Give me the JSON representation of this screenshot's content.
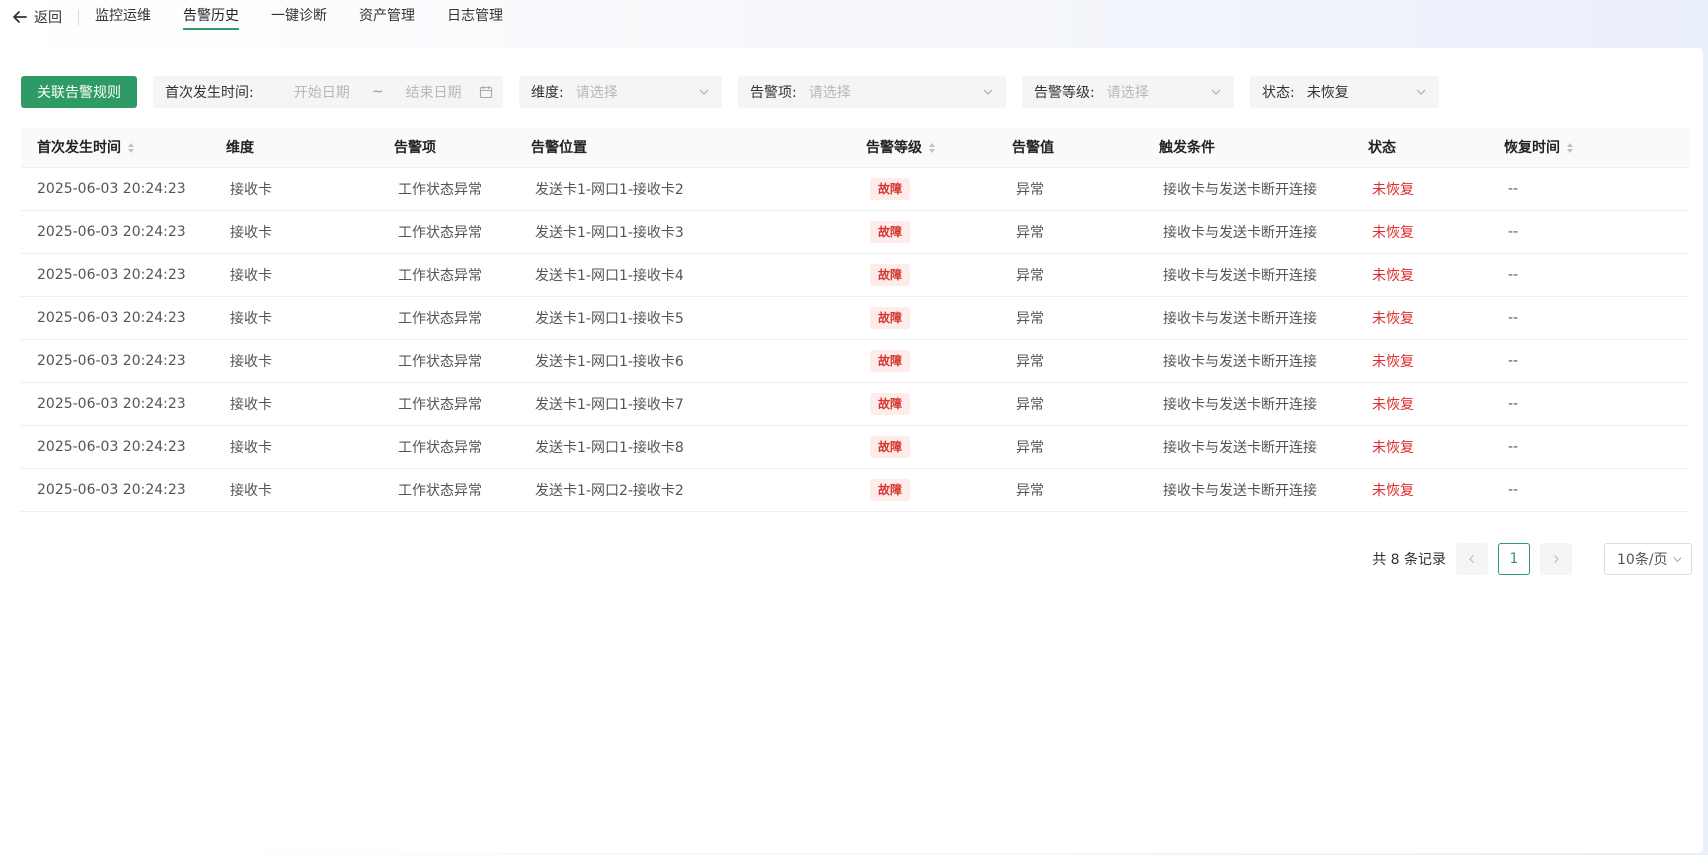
{
  "nav": {
    "back_label": "返回",
    "tabs": [
      {
        "label": "监控运维"
      },
      {
        "label": "告警历史"
      },
      {
        "label": "一键诊断"
      },
      {
        "label": "资产管理"
      },
      {
        "label": "日志管理"
      }
    ],
    "active_tab": 1
  },
  "filters": {
    "rule_button": "关联告警规则",
    "time_label": "首次发生时间:",
    "start_placeholder": "开始日期",
    "range_sep": "~",
    "end_placeholder": "结束日期",
    "dimension_label": "维度:",
    "dimension_placeholder": "请选择",
    "item_label": "告警项:",
    "item_placeholder": "请选择",
    "level_label": "告警等级:",
    "level_placeholder": "请选择",
    "status_label": "状态:",
    "status_value": "未恢复"
  },
  "table": {
    "headers": {
      "time": "首次发生时间",
      "dimension": "维度",
      "item": "告警项",
      "location": "告警位置",
      "level": "告警等级",
      "value": "告警值",
      "condition": "触发条件",
      "status": "状态",
      "recover_time": "恢复时间"
    },
    "rows": [
      {
        "time": "2025-06-03 20:24:23",
        "dimension": "接收卡",
        "item": "工作状态异常",
        "location": "发送卡1-网口1-接收卡2",
        "level": "故障",
        "value": "异常",
        "condition": "接收卡与发送卡断开连接",
        "status": "未恢复",
        "recover_time": "--"
      },
      {
        "time": "2025-06-03 20:24:23",
        "dimension": "接收卡",
        "item": "工作状态异常",
        "location": "发送卡1-网口1-接收卡3",
        "level": "故障",
        "value": "异常",
        "condition": "接收卡与发送卡断开连接",
        "status": "未恢复",
        "recover_time": "--"
      },
      {
        "time": "2025-06-03 20:24:23",
        "dimension": "接收卡",
        "item": "工作状态异常",
        "location": "发送卡1-网口1-接收卡4",
        "level": "故障",
        "value": "异常",
        "condition": "接收卡与发送卡断开连接",
        "status": "未恢复",
        "recover_time": "--"
      },
      {
        "time": "2025-06-03 20:24:23",
        "dimension": "接收卡",
        "item": "工作状态异常",
        "location": "发送卡1-网口1-接收卡5",
        "level": "故障",
        "value": "异常",
        "condition": "接收卡与发送卡断开连接",
        "status": "未恢复",
        "recover_time": "--"
      },
      {
        "time": "2025-06-03 20:24:23",
        "dimension": "接收卡",
        "item": "工作状态异常",
        "location": "发送卡1-网口1-接收卡6",
        "level": "故障",
        "value": "异常",
        "condition": "接收卡与发送卡断开连接",
        "status": "未恢复",
        "recover_time": "--"
      },
      {
        "time": "2025-06-03 20:24:23",
        "dimension": "接收卡",
        "item": "工作状态异常",
        "location": "发送卡1-网口1-接收卡7",
        "level": "故障",
        "value": "异常",
        "condition": "接收卡与发送卡断开连接",
        "status": "未恢复",
        "recover_time": "--"
      },
      {
        "time": "2025-06-03 20:24:23",
        "dimension": "接收卡",
        "item": "工作状态异常",
        "location": "发送卡1-网口1-接收卡8",
        "level": "故障",
        "value": "异常",
        "condition": "接收卡与发送卡断开连接",
        "status": "未恢复",
        "recover_time": "--"
      },
      {
        "time": "2025-06-03 20:24:23",
        "dimension": "接收卡",
        "item": "工作状态异常",
        "location": "发送卡1-网口2-接收卡2",
        "level": "故障",
        "value": "异常",
        "condition": "接收卡与发送卡断开连接",
        "status": "未恢复",
        "recover_time": "--"
      }
    ]
  },
  "pagination": {
    "total_text": "共 8 条记录",
    "prev_icon": "<",
    "current_page": "1",
    "next_icon": ">",
    "page_size": "10条/页"
  },
  "colors": {
    "accent": "#2e9a65",
    "fault_badge_bg": "#fdecea",
    "fault_badge_text": "#d4352e",
    "status_unrecovered": "#e02c2c"
  }
}
